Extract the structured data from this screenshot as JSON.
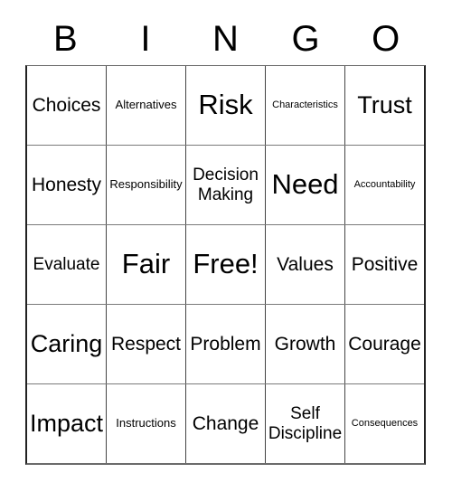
{
  "card": {
    "header_letters": [
      "B",
      "I",
      "N",
      "G",
      "O"
    ],
    "rows": [
      [
        {
          "label": "Choices",
          "size": "md"
        },
        {
          "label": "Alternatives",
          "size": "xs"
        },
        {
          "label": "Risk",
          "size": "xl"
        },
        {
          "label": "Characteristics",
          "size": "xxs"
        },
        {
          "label": "Trust",
          "size": "lg"
        }
      ],
      [
        {
          "label": "Honesty",
          "size": "md"
        },
        {
          "label": "Responsibility",
          "size": "xs"
        },
        {
          "label": "Decision\nMaking",
          "size": "sm"
        },
        {
          "label": "Need",
          "size": "xl"
        },
        {
          "label": "Accountability",
          "size": "xxs"
        }
      ],
      [
        {
          "label": "Evaluate",
          "size": "sm"
        },
        {
          "label": "Fair",
          "size": "xl"
        },
        {
          "label": "Free!",
          "size": "xl"
        },
        {
          "label": "Values",
          "size": "md"
        },
        {
          "label": "Positive",
          "size": "md"
        }
      ],
      [
        {
          "label": "Caring",
          "size": "lg"
        },
        {
          "label": "Respect",
          "size": "md"
        },
        {
          "label": "Problem",
          "size": "md"
        },
        {
          "label": "Growth",
          "size": "md"
        },
        {
          "label": "Courage",
          "size": "md"
        }
      ],
      [
        {
          "label": "Impact",
          "size": "lg"
        },
        {
          "label": "Instructions",
          "size": "xs"
        },
        {
          "label": "Change",
          "size": "md"
        },
        {
          "label": "Self\nDiscipline",
          "size": "sm"
        },
        {
          "label": "Consequences",
          "size": "xxs"
        }
      ]
    ]
  },
  "colors": {
    "background": "#ffffff",
    "text": "#000000",
    "grid_line": "#444444",
    "grid_border": "#222222"
  }
}
